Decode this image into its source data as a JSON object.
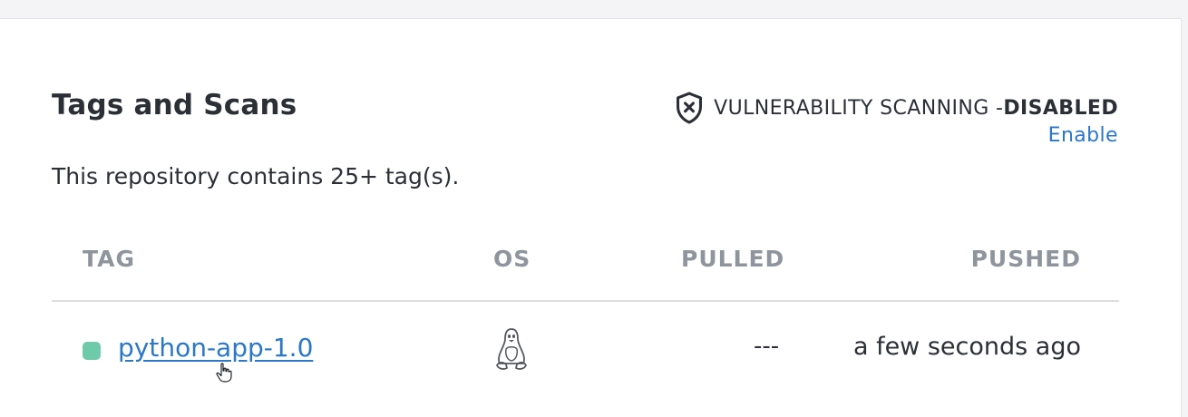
{
  "section": {
    "title": "Tags and Scans",
    "description": "This repository contains 25+ tag(s)."
  },
  "scanning": {
    "icon": "shield-x-icon",
    "label": "VULNERABILITY SCANNING - ",
    "status": "DISABLED",
    "enable_label": "Enable"
  },
  "table": {
    "headers": {
      "tag": "TAG",
      "os": "OS",
      "pulled": "PULLED",
      "pushed": "PUSHED"
    },
    "rows": [
      {
        "status_color": "#6fcaa9",
        "tag": "python-app-1.0",
        "os_icon": "linux-icon",
        "pulled": "---",
        "pushed": "a few seconds ago"
      }
    ]
  },
  "colors": {
    "link": "#2b77c8",
    "status_ok": "#6fcaa9",
    "header_text": "#8f959c"
  }
}
